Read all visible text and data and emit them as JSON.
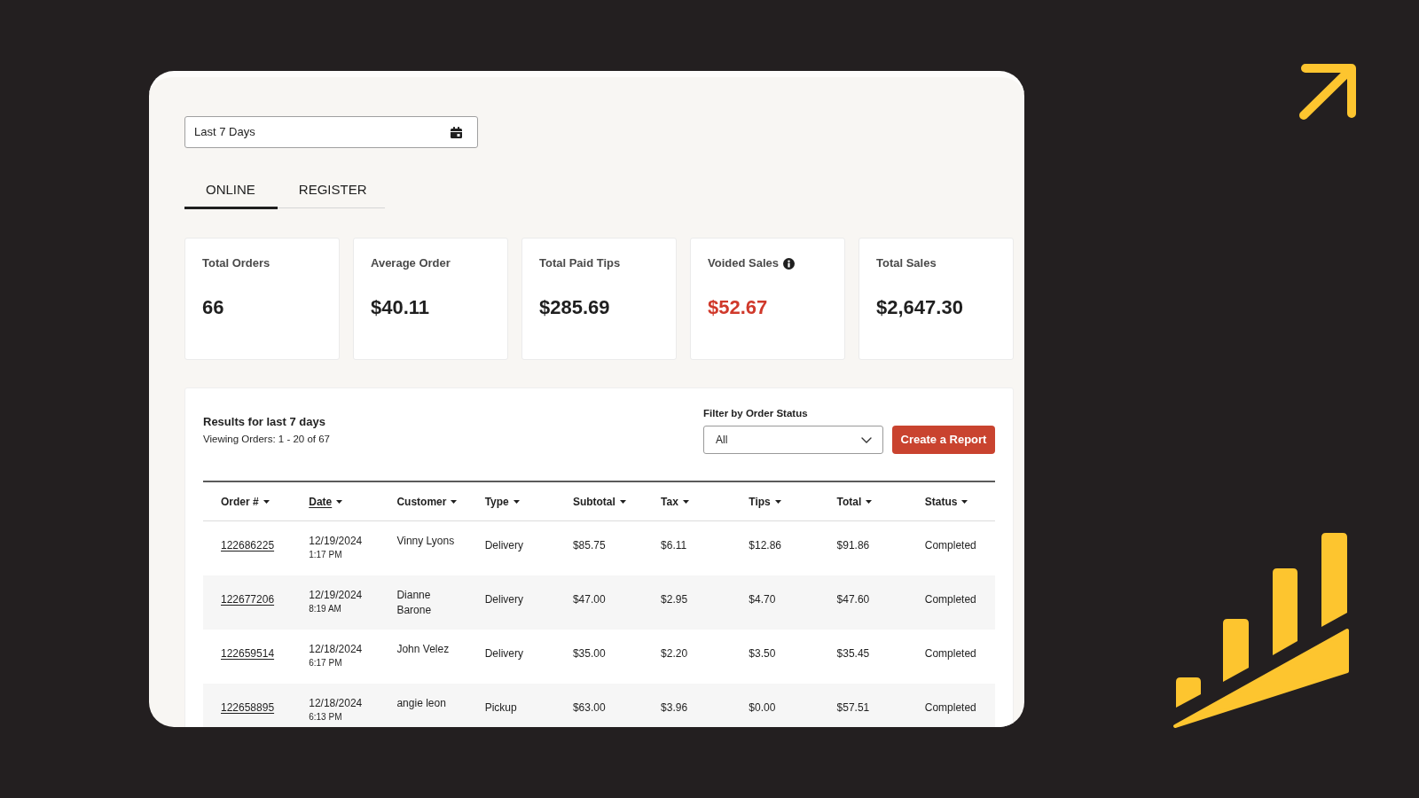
{
  "date_range": {
    "value": "Last 7 Days"
  },
  "tabs": [
    {
      "label": "ONLINE",
      "selected": true
    },
    {
      "label": "REGISTER",
      "selected": false
    }
  ],
  "stats": [
    {
      "label": "Total Orders",
      "value": "66",
      "info": false,
      "alert": false
    },
    {
      "label": "Average Order",
      "value": "$40.11",
      "info": false,
      "alert": false
    },
    {
      "label": "Total Paid Tips",
      "value": "$285.69",
      "info": false,
      "alert": false
    },
    {
      "label": "Voided Sales",
      "value": "$52.67",
      "info": true,
      "alert": true
    },
    {
      "label": "Total Sales",
      "value": "$2,647.30",
      "info": false,
      "alert": false
    }
  ],
  "results": {
    "title": "Results for last 7 days",
    "subtitle": "Viewing Orders: 1 - 20 of 67"
  },
  "filter": {
    "label": "Filter by Order Status",
    "value": "All"
  },
  "report_button": {
    "label": "Create a Report"
  },
  "table": {
    "columns": [
      {
        "label": "Order #",
        "active": false
      },
      {
        "label": "Date",
        "active": true
      },
      {
        "label": "Customer",
        "active": false
      },
      {
        "label": "Type",
        "active": false
      },
      {
        "label": "Subtotal",
        "active": false
      },
      {
        "label": "Tax",
        "active": false
      },
      {
        "label": "Tips",
        "active": false
      },
      {
        "label": "Total",
        "active": false
      },
      {
        "label": "Status",
        "active": false
      }
    ],
    "rows": [
      {
        "order": "122686225",
        "date": "12/19/2024",
        "time": "1:17 PM",
        "customer": "Vinny Lyons",
        "type": "Delivery",
        "subtotal": "$85.75",
        "tax": "$6.11",
        "tips": "$12.86",
        "total": "$91.86",
        "status": "Completed"
      },
      {
        "order": "122677206",
        "date": "12/19/2024",
        "time": "8:19 AM",
        "customer": "Dianne Barone",
        "type": "Delivery",
        "subtotal": "$47.00",
        "tax": "$2.95",
        "tips": "$4.70",
        "total": "$47.60",
        "status": "Completed"
      },
      {
        "order": "122659514",
        "date": "12/18/2024",
        "time": "6:17 PM",
        "customer": "John Velez",
        "type": "Delivery",
        "subtotal": "$35.00",
        "tax": "$2.20",
        "tips": "$3.50",
        "total": "$35.45",
        "status": "Completed"
      },
      {
        "order": "122658895",
        "date": "12/18/2024",
        "time": "6:13 PM",
        "customer": "angie leon",
        "type": "Pickup",
        "subtotal": "$63.00",
        "tax": "$3.96",
        "tips": "$0.00",
        "total": "$57.51",
        "status": "Completed"
      }
    ]
  }
}
